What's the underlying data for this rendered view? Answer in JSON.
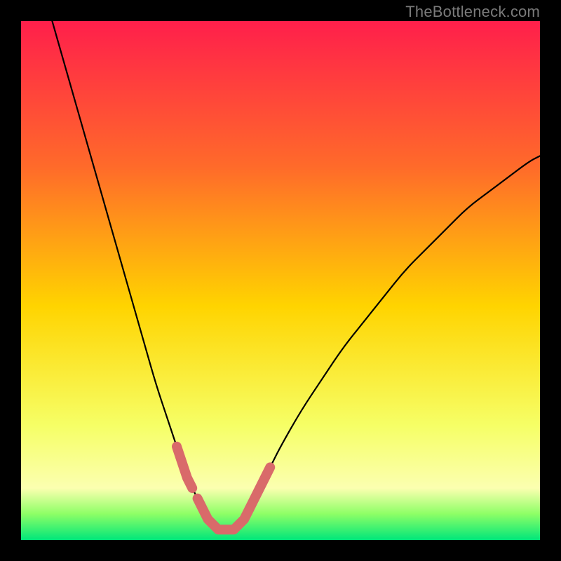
{
  "attribution": "TheBottleneck.com",
  "colors": {
    "background_black": "#000000",
    "gradient_top": "#ff1f4b",
    "gradient_mid_upper": "#ff6a2a",
    "gradient_mid": "#ffd400",
    "gradient_lower": "#f6ff66",
    "gradient_bottom_yellow": "#fbffb0",
    "gradient_green1": "#8dff66",
    "gradient_green2": "#00e67a",
    "curve": "#000000",
    "highlight": "#d96a6a"
  },
  "chart_data": {
    "type": "line",
    "title": "",
    "xlabel": "",
    "ylabel": "",
    "xlim": [
      0,
      100
    ],
    "ylim": [
      0,
      100
    ],
    "series": [
      {
        "name": "bottleneck-curve",
        "x": [
          6,
          8,
          10,
          12,
          14,
          16,
          18,
          20,
          22,
          24,
          26,
          28,
          30,
          32,
          33,
          34,
          35,
          36,
          37,
          38,
          39,
          40,
          41,
          42,
          43,
          44,
          46,
          48,
          50,
          54,
          58,
          62,
          66,
          70,
          74,
          78,
          82,
          86,
          90,
          94,
          98,
          100
        ],
        "y": [
          100,
          93,
          86,
          79,
          72,
          65,
          58,
          51,
          44,
          37,
          30,
          24,
          18,
          12,
          10,
          8,
          6,
          4,
          3,
          2,
          2,
          2,
          2,
          3,
          4,
          6,
          10,
          14,
          18,
          25,
          31,
          37,
          42,
          47,
          52,
          56,
          60,
          64,
          67,
          70,
          73,
          74
        ]
      }
    ],
    "highlight_segments": [
      {
        "x": [
          30,
          32,
          33
        ],
        "y": [
          18,
          12,
          10
        ]
      },
      {
        "x": [
          34,
          35,
          36,
          37,
          38,
          39,
          40,
          41,
          42,
          43,
          44
        ],
        "y": [
          8,
          6,
          4,
          3,
          2,
          2,
          2,
          2,
          3,
          4,
          6
        ]
      },
      {
        "x": [
          44,
          46,
          48
        ],
        "y": [
          6,
          10,
          14
        ]
      }
    ]
  }
}
